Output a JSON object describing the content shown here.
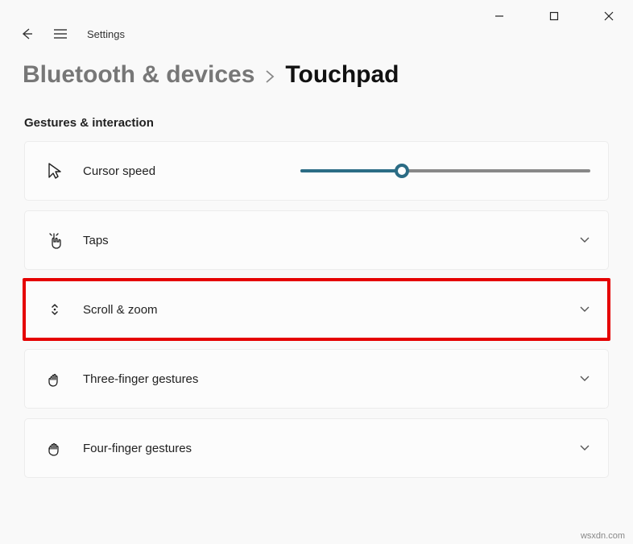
{
  "window": {
    "app_title": "Settings"
  },
  "breadcrumb": {
    "parent": "Bluetooth & devices",
    "current": "Touchpad"
  },
  "section": {
    "title": "Gestures & interaction"
  },
  "cards": {
    "cursor_speed": {
      "label": "Cursor speed",
      "slider_percent": 35
    },
    "taps": {
      "label": "Taps"
    },
    "scroll_zoom": {
      "label": "Scroll & zoom"
    },
    "three_finger": {
      "label": "Three-finger gestures"
    },
    "four_finger": {
      "label": "Four-finger gestures"
    }
  },
  "watermark": "wsxdn.com"
}
